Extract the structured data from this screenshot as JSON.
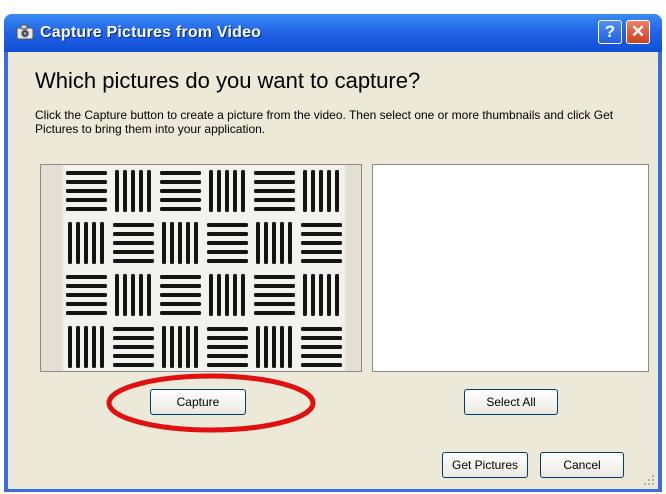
{
  "window": {
    "title": "Capture Pictures from Video",
    "help_glyph": "?",
    "close_glyph": "✕",
    "app_icon": "camera-icon",
    "titlebar_color": "#0f4fd6",
    "face_color": "#ece9d8"
  },
  "dialog": {
    "heading": "Which pictures do you want to capture?",
    "instructions": "Click the Capture button to create a picture from the video.  Then select one or more thumbnails and click Get Pictures to bring them into your application."
  },
  "buttons": {
    "capture": "Capture",
    "select_all": "Select All",
    "get_pictures": "Get Pictures",
    "cancel": "Cancel"
  },
  "annotation": {
    "highlight_color": "#e01010"
  }
}
